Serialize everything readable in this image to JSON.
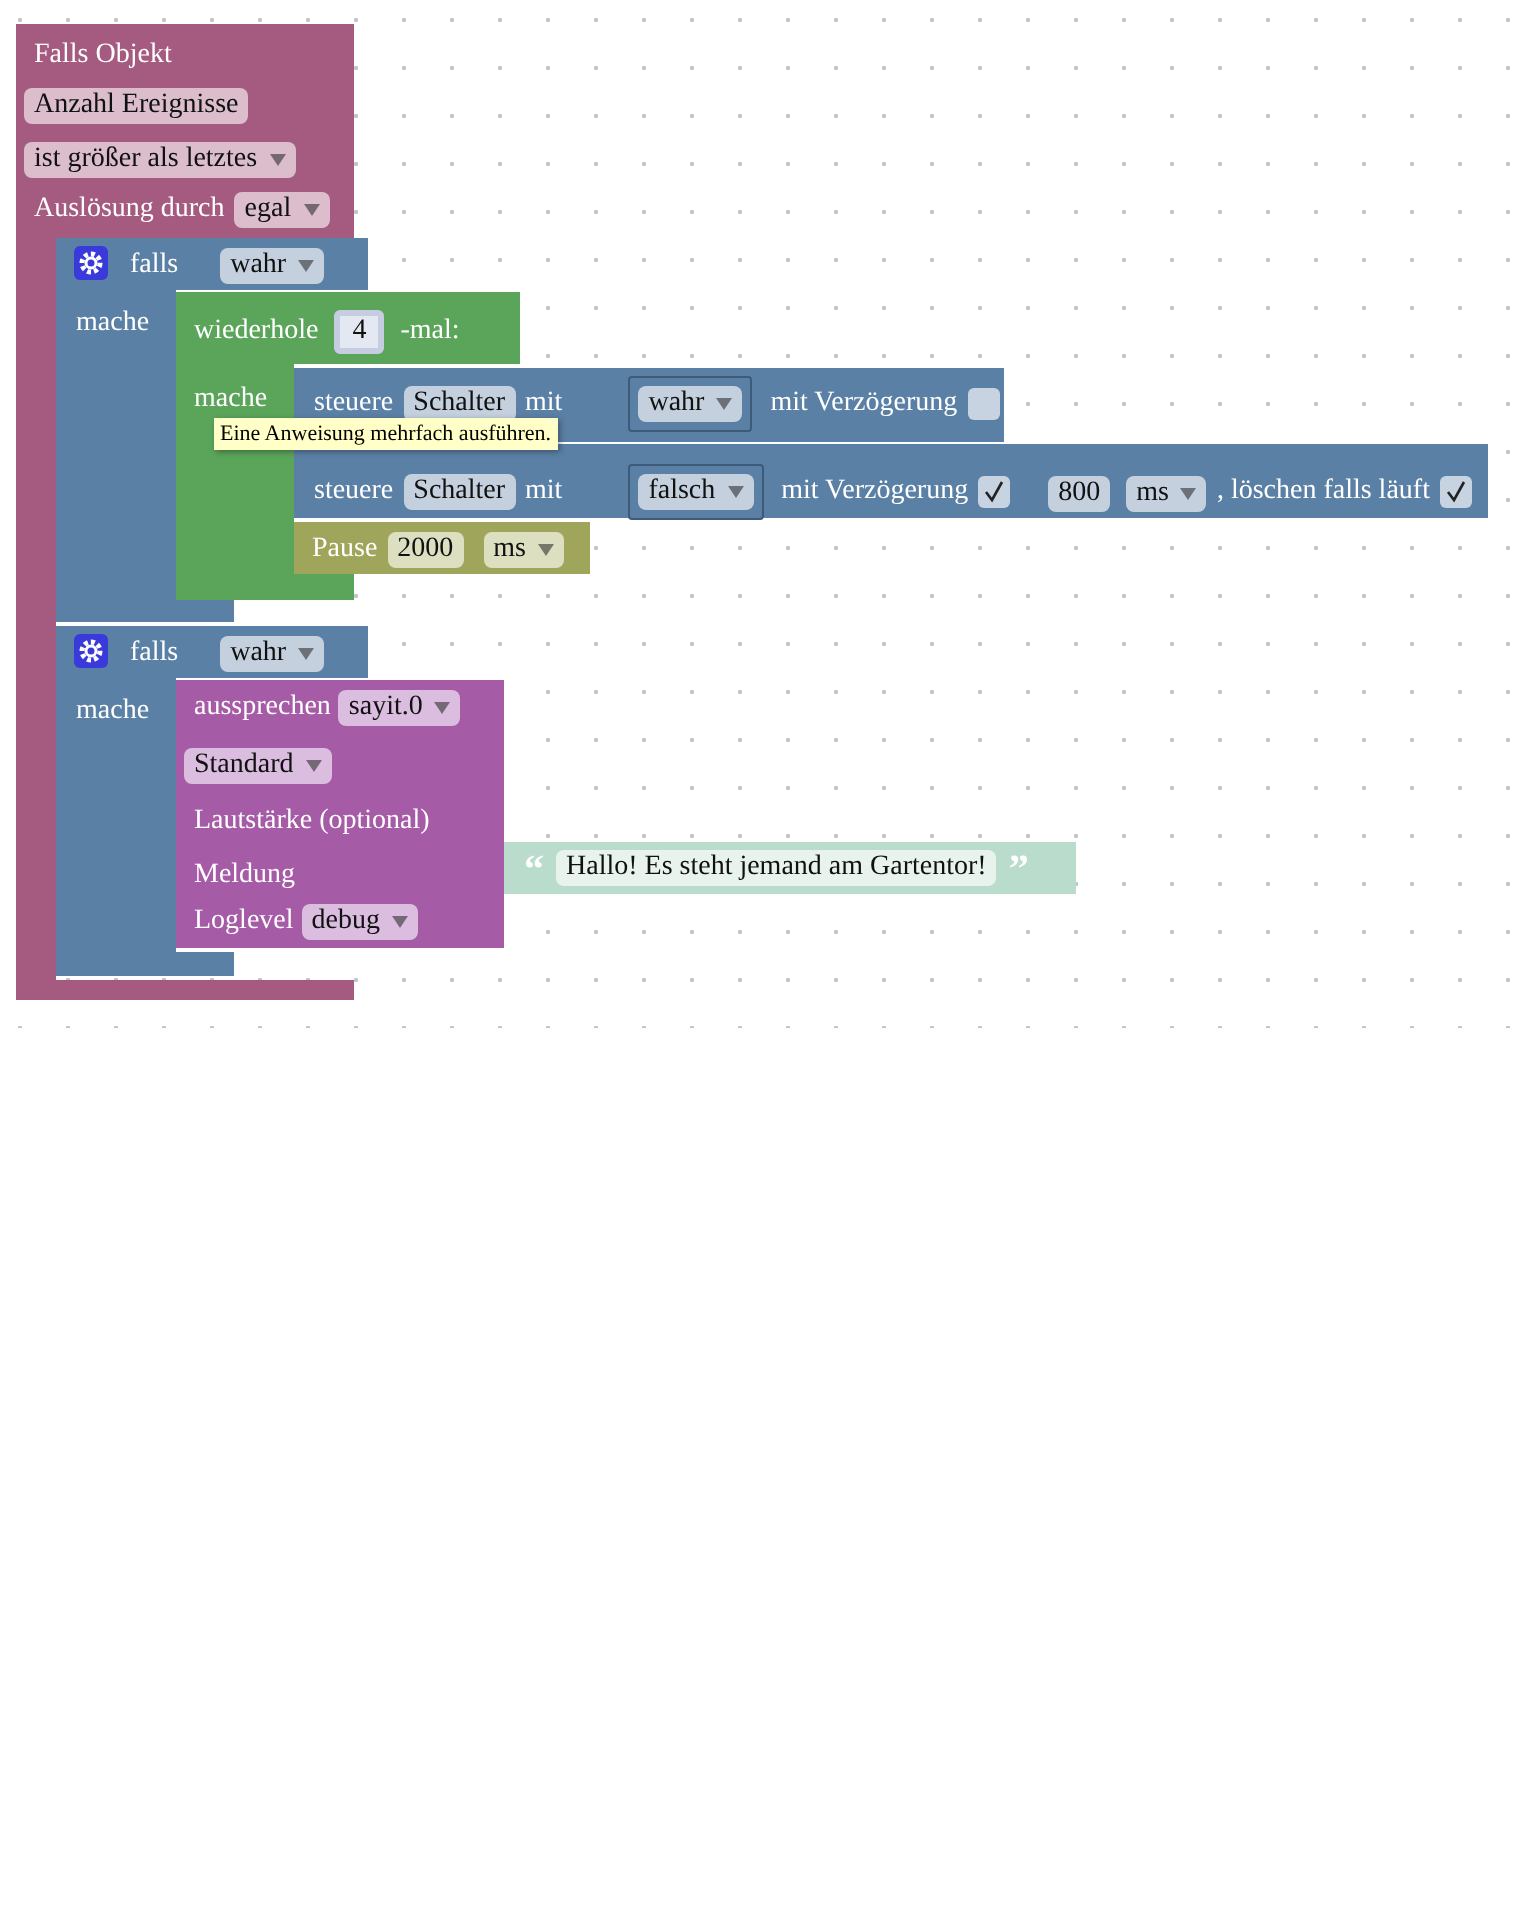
{
  "event_block": {
    "title": "Falls Objekt",
    "object": "Anzahl Ereignisse",
    "condition": "ist größer als letztes",
    "trigger_label": "Auslösung durch",
    "trigger": "egal"
  },
  "if_blocks": [
    {
      "label": "falls",
      "value": "wahr",
      "do_label": "mache"
    },
    {
      "label": "falls",
      "value": "wahr",
      "do_label": "mache"
    }
  ],
  "repeat_block": {
    "label": "wiederhole",
    "times": "4",
    "suffix": "-mal:",
    "do_label": "mache",
    "tooltip": "Eine Anweisung mehrfach ausführen."
  },
  "control_blocks": [
    {
      "verb": "steuere",
      "target": "Schalter",
      "with_label": "mit",
      "value": "wahr",
      "delay_label": "mit Verzögerung",
      "delay_checked": false
    },
    {
      "verb": "steuere",
      "target": "Schalter",
      "with_label": "mit",
      "value": "falsch",
      "delay_label": "mit Verzögerung",
      "delay_checked": true,
      "delay": "800",
      "unit": "ms",
      "clear_label": ", löschen falls läuft",
      "clear_checked": true
    }
  ],
  "pause_block": {
    "label": "Pause",
    "value": "2000",
    "unit": "ms"
  },
  "say_block": {
    "label": "aussprechen",
    "instance": "sayit.0",
    "language": "Standard",
    "volume_label": "Lautstärke (optional)",
    "message_label": "Meldung",
    "loglevel_label": "Loglevel",
    "loglevel": "debug"
  },
  "text_block": {
    "open_quote": "“",
    "text": "Hallo! Es steht jemand am Gartentor!",
    "close_quote": "”"
  }
}
